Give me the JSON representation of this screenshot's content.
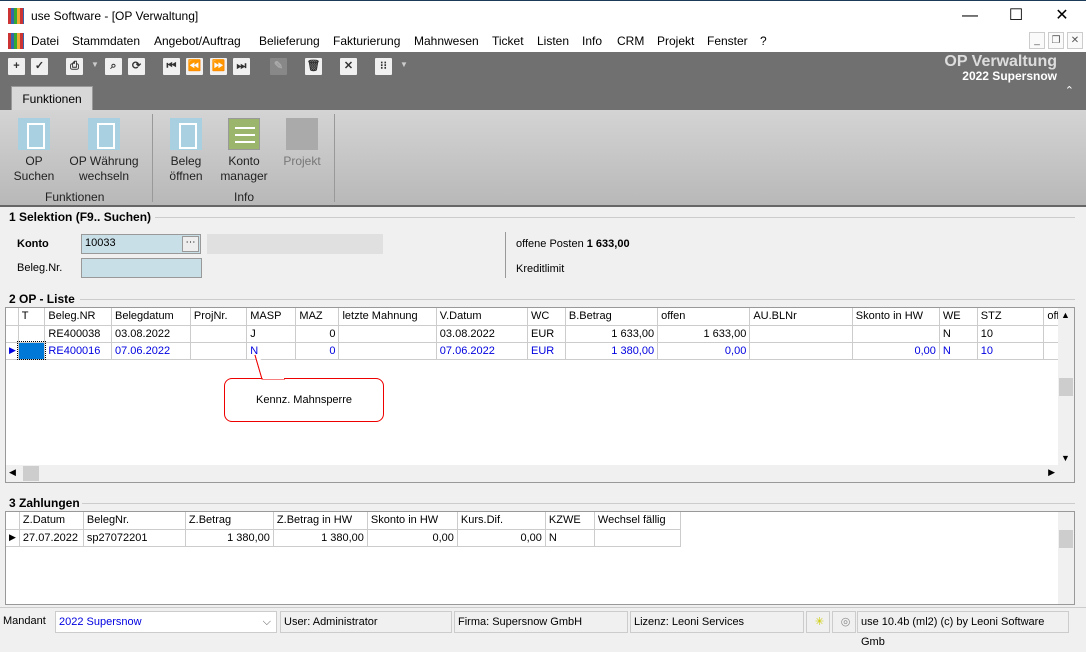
{
  "window": {
    "title": "use Software - [OP Verwaltung]"
  },
  "menu": [
    "Datei",
    "Stammdaten",
    "Angebot/Auftrag",
    "Belieferung",
    "Fakturierung",
    "Mahnwesen",
    "Ticket",
    "Listen",
    "Info",
    "CRM",
    "Projekt",
    "Fenster",
    "?"
  ],
  "header": {
    "title": "OP Verwaltung",
    "subtitle": "2022 Supersnow"
  },
  "ribbon": {
    "tab": "Funktionen",
    "groups": [
      {
        "label": "Funktionen",
        "buttons": [
          {
            "label1": "OP",
            "label2": "Suchen",
            "icon": "document-icon"
          },
          {
            "label1": "OP Währung",
            "label2": "wechseln",
            "icon": "document-icon"
          }
        ]
      },
      {
        "label": "Info",
        "buttons": [
          {
            "label1": "Beleg",
            "label2": "öffnen",
            "icon": "document-icon"
          },
          {
            "label1": "Konto",
            "label2": "manager",
            "icon": "list-icon"
          },
          {
            "label1": "Projekt",
            "label2": "",
            "icon": "grid-icon",
            "disabled": true
          }
        ]
      }
    ]
  },
  "selektion": {
    "title": "1 Selektion (F9.. Suchen)",
    "konto_label": "Konto",
    "konto_value": "10033",
    "beleg_label": "Beleg.Nr.",
    "beleg_value": "",
    "offene_label": "offene Posten",
    "offene_value": "1 633,00",
    "kreditlimit_label": "Kreditlimit"
  },
  "op_liste": {
    "title": "2 OP - Liste",
    "columns": [
      "T",
      "Beleg.NR",
      "Belegdatum",
      "ProjNr.",
      "MASP",
      "MAZ",
      "letzte Mahnung",
      "V.Datum",
      "WC",
      "B.Betrag",
      "offen",
      "AU.BLNr",
      "Skonto in HW",
      "WE",
      "STZ",
      "offen in"
    ],
    "rows": [
      [
        "",
        "RE400038",
        "03.08.2022",
        "",
        "J",
        "0",
        "",
        "03.08.2022",
        "EUR",
        "1 633,00",
        "1 633,00",
        "",
        "",
        "N",
        "10",
        ""
      ],
      [
        "",
        "RE400016",
        "07.06.2022",
        "",
        "N",
        "0",
        "",
        "07.06.2022",
        "EUR",
        "1 380,00",
        "0,00",
        "",
        "0,00",
        "N",
        "10",
        ""
      ]
    ],
    "selected_row": 1
  },
  "callout": "Kennz. Mahnsperre",
  "zahlungen": {
    "title": "3 Zahlungen",
    "columns": [
      "Z.Datum",
      "BelegNr.",
      "Z.Betrag",
      "Z.Betrag in HW",
      "Skonto in HW",
      "Kurs.Dif.",
      "KZWE",
      "Wechsel fällig"
    ],
    "rows": [
      [
        "27.07.2022",
        "sp27072201",
        "1 380,00",
        "1 380,00",
        "0,00",
        "0,00",
        "N",
        ""
      ]
    ]
  },
  "status": {
    "mandant_label": "Mandant",
    "mandant_value": "2022 Supersnow",
    "user": "User: Administrator",
    "firma": "Firma: Supersnow GmbH",
    "lizenz": "Lizenz: Leoni Services",
    "version": "use 10.4b (ml2) (c) by Leoni Software Gmb"
  },
  "colors": {
    "toolbar": "#707070",
    "selected_text": "#0000e0",
    "callout_border": "#ee0000"
  }
}
